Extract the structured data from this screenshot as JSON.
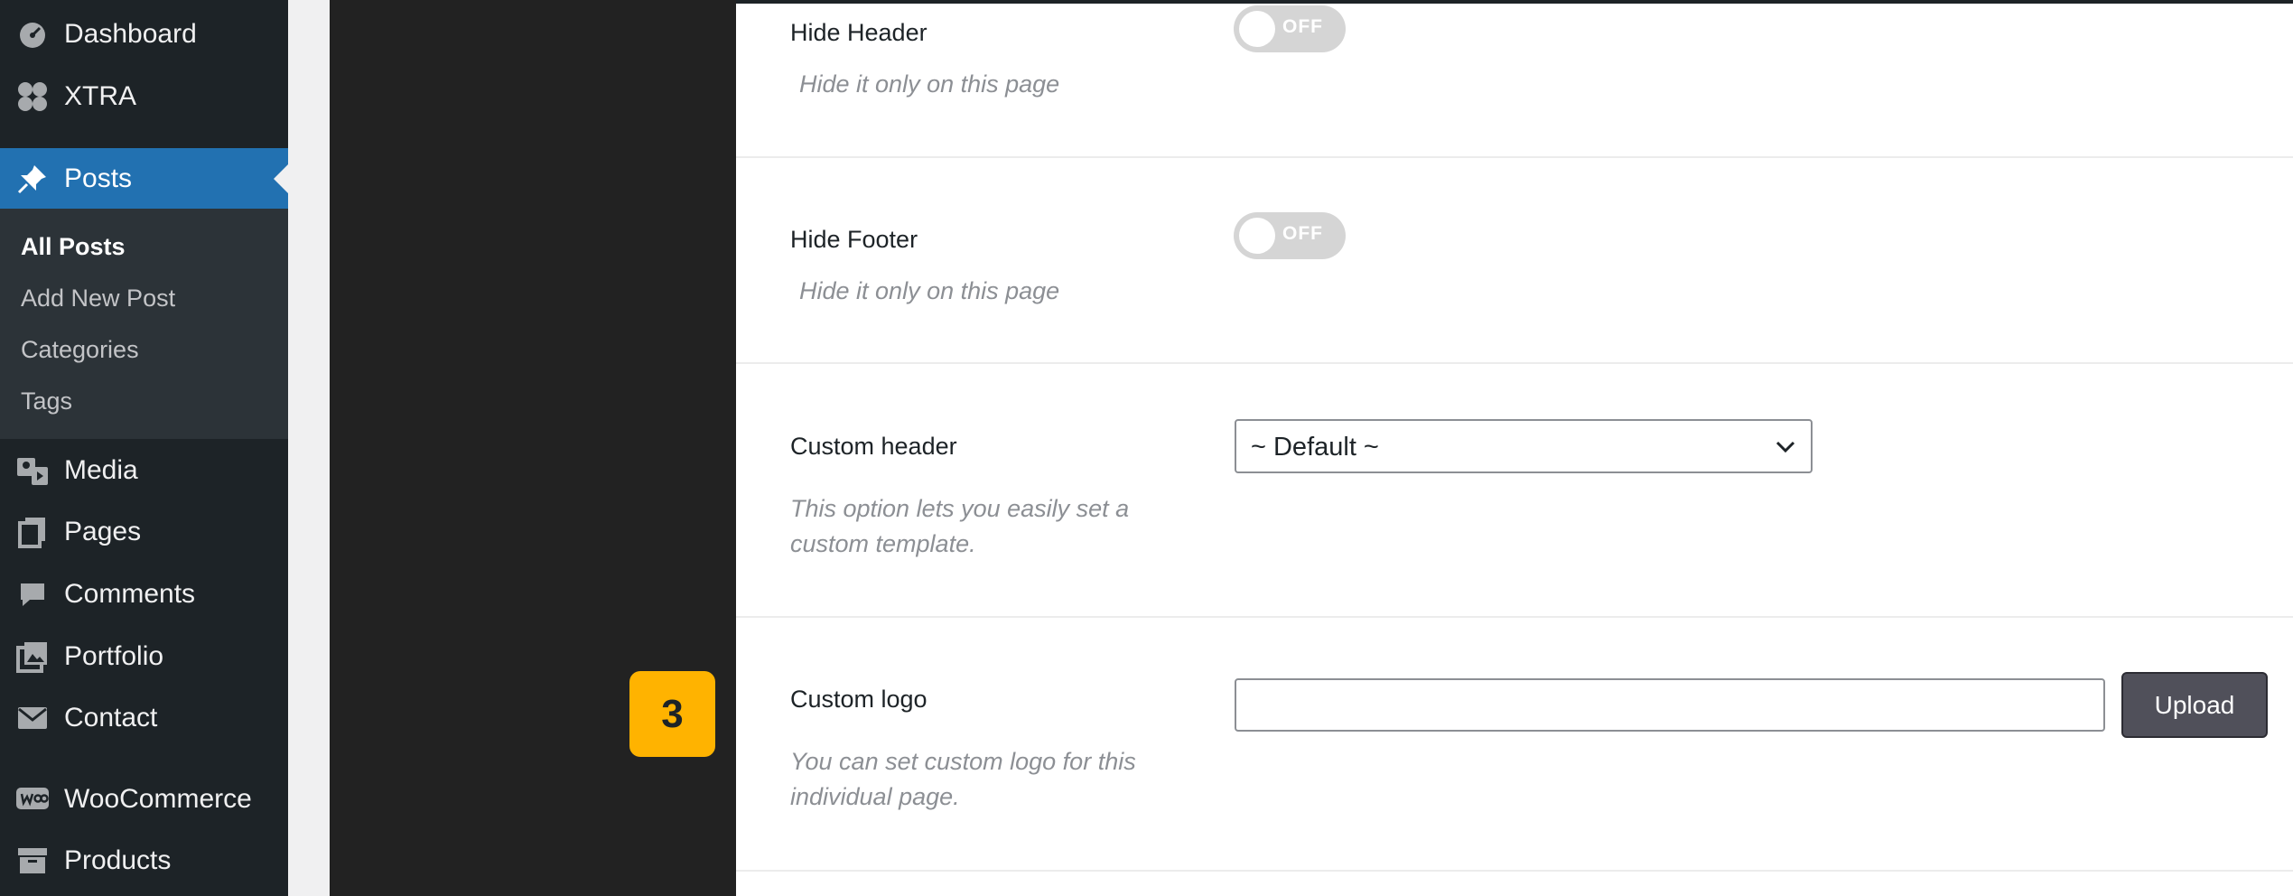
{
  "sidebar": {
    "items": [
      {
        "label": "Dashboard",
        "icon": "dashboard-icon"
      },
      {
        "label": "XTRA",
        "icon": "xtra-icon"
      },
      {
        "label": "Posts",
        "icon": "pin-icon"
      },
      {
        "label": "Media",
        "icon": "media-icon"
      },
      {
        "label": "Pages",
        "icon": "pages-icon"
      },
      {
        "label": "Comments",
        "icon": "comment-icon"
      },
      {
        "label": "Portfolio",
        "icon": "portfolio-icon"
      },
      {
        "label": "Contact",
        "icon": "mail-icon"
      },
      {
        "label": "WooCommerce",
        "icon": "woo-icon"
      },
      {
        "label": "Products",
        "icon": "archive-icon"
      }
    ],
    "active_item": "Posts",
    "submenu": [
      "All Posts",
      "Add New Post",
      "Categories",
      "Tags"
    ],
    "current_submenu": "All Posts"
  },
  "step_badge": "3",
  "options": {
    "hide_header": {
      "label": "Hide Header",
      "description": "Hide it only on this page",
      "toggle": "OFF"
    },
    "hide_footer": {
      "label": "Hide Footer",
      "description": "Hide it only on this page",
      "toggle": "OFF"
    },
    "custom_header": {
      "label": "Custom header",
      "description": "This option lets you easily set a custom template.",
      "selected": "~ Default ~"
    },
    "custom_logo": {
      "label": "Custom logo",
      "description": "You can set custom logo for this individual page.",
      "value": "",
      "button": "Upload"
    }
  },
  "colors": {
    "admin_menu_bg": "#1d2327",
    "active_blue": "#2271b1",
    "badge_orange": "#ffb300",
    "upload_button": "#50505a"
  }
}
